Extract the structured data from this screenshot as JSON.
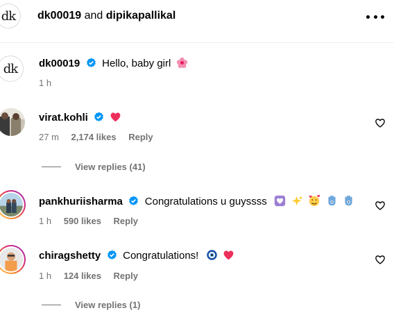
{
  "header": {
    "user1": "dk00019",
    "joiner": "and",
    "user2": "dipikapallikal",
    "avatar_letters": "dk"
  },
  "caption": {
    "username": "dk00019",
    "text": "Hello, baby girl",
    "time": "1 h",
    "avatar_letters": "dk"
  },
  "comments": [
    {
      "username": "virat.kohli",
      "text": "",
      "time": "27 m",
      "likes": "2,174 likes",
      "reply": "Reply",
      "view_replies": "View replies (41)"
    },
    {
      "username": "pankhuriisharma",
      "text": "Congratulations u guyssss",
      "time": "1 h",
      "likes": "590 likes",
      "reply": "Reply"
    },
    {
      "username": "chiragshetty",
      "text": "Congratulations!",
      "time": "1 h",
      "likes": "124 likes",
      "reply": "Reply",
      "view_replies": "View replies (1)"
    }
  ],
  "colors": {
    "verified": "#0095f6",
    "heart_red": "#ed2f5b",
    "meta_gray": "#737373"
  }
}
